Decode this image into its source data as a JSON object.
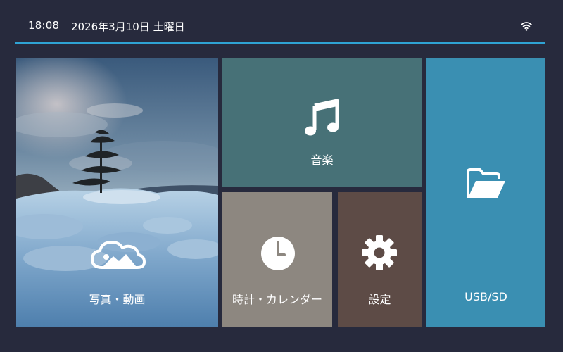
{
  "status_bar": {
    "time": "18:08",
    "date": "2026年3月10日 土曜日",
    "wifi_icon": "wifi-icon"
  },
  "colors": {
    "background": "#272a3d",
    "accent_line": "#2fa3d4",
    "music_tile": "#477177",
    "clock_tile": "#8d8780",
    "settings_tile": "#5d4b46",
    "usb_tile": "#3a8fb2"
  },
  "tiles": {
    "photos": {
      "label": "写真・動画",
      "icon": "cloud-image-icon"
    },
    "music": {
      "label": "音楽",
      "icon": "music-note-icon"
    },
    "clock": {
      "label": "時計・カレンダー",
      "icon": "clock-icon"
    },
    "settings": {
      "label": "設定",
      "icon": "gear-icon"
    },
    "usb": {
      "label": "USB/SD",
      "icon": "folder-open-icon"
    }
  }
}
